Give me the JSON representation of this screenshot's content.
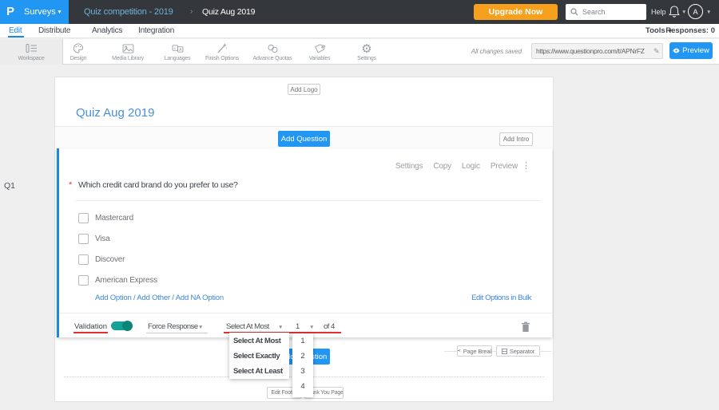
{
  "topbar": {
    "logo": "P",
    "product_menu": "Surveys",
    "breadcrumb": {
      "parent": "Quiz competition - 2019",
      "separator": "›",
      "current": "Quiz Aug 2019"
    },
    "upgrade_button": "Upgrade Now",
    "search_placeholder": "Search",
    "help": "Help",
    "avatar_initial": "A"
  },
  "nav": {
    "items": [
      "Edit",
      "Distribute",
      "Analytics",
      "Integration"
    ],
    "active": "Edit",
    "tools": "Tools",
    "responses": "Responses: 0"
  },
  "toolbar": {
    "items": [
      "Workspace",
      "Design",
      "Media Library",
      "Languages",
      "Finish Options",
      "Advance Quotas",
      "Variables",
      "Settings"
    ],
    "selected": "Workspace",
    "autosave_status": "All changes saved",
    "survey_url": "https://www.questionpro.com/t/APNrFZ",
    "preview_button": "Preview"
  },
  "survey": {
    "add_logo_button": "Add Logo",
    "title": "Quiz Aug 2019",
    "add_question_button": "Add Question",
    "add_intro_button": "Add Intro",
    "question_number": "Q1",
    "question": {
      "menu": [
        "Settings",
        "Copy",
        "Logic",
        "Preview"
      ],
      "required_marker": "*",
      "text": "Which credit card brand do you prefer to use?",
      "options": [
        "Mastercard",
        "Visa",
        "Discover",
        "American Express"
      ],
      "option_links": [
        "Add Option",
        "Add Other",
        "Add NA Option"
      ],
      "links_separator": "/",
      "bulk_edit_link": "Edit Options in Bulk",
      "validation_label": "Validation",
      "validation_on": true,
      "force_response_label": "Force Response",
      "rule_selected": "Select At Most",
      "count_selected": "1",
      "of_total": "of 4"
    },
    "rule_dropdown_options": [
      "Select At Most",
      "Select Exactly",
      "Select At Least"
    ],
    "count_dropdown_options": [
      "1",
      "2",
      "3",
      "4"
    ],
    "page_break_button": "Page Break",
    "separator_button": "Separator",
    "edit_footer_button": "Edit Footer",
    "thank_you_button": "Thank You Page"
  },
  "colors": {
    "accent_blue": "#2196f3",
    "link_blue": "#1b87e6",
    "orange": "#f7a01d",
    "toggle_teal": "#15a296",
    "annotation_red": "#e03131"
  }
}
